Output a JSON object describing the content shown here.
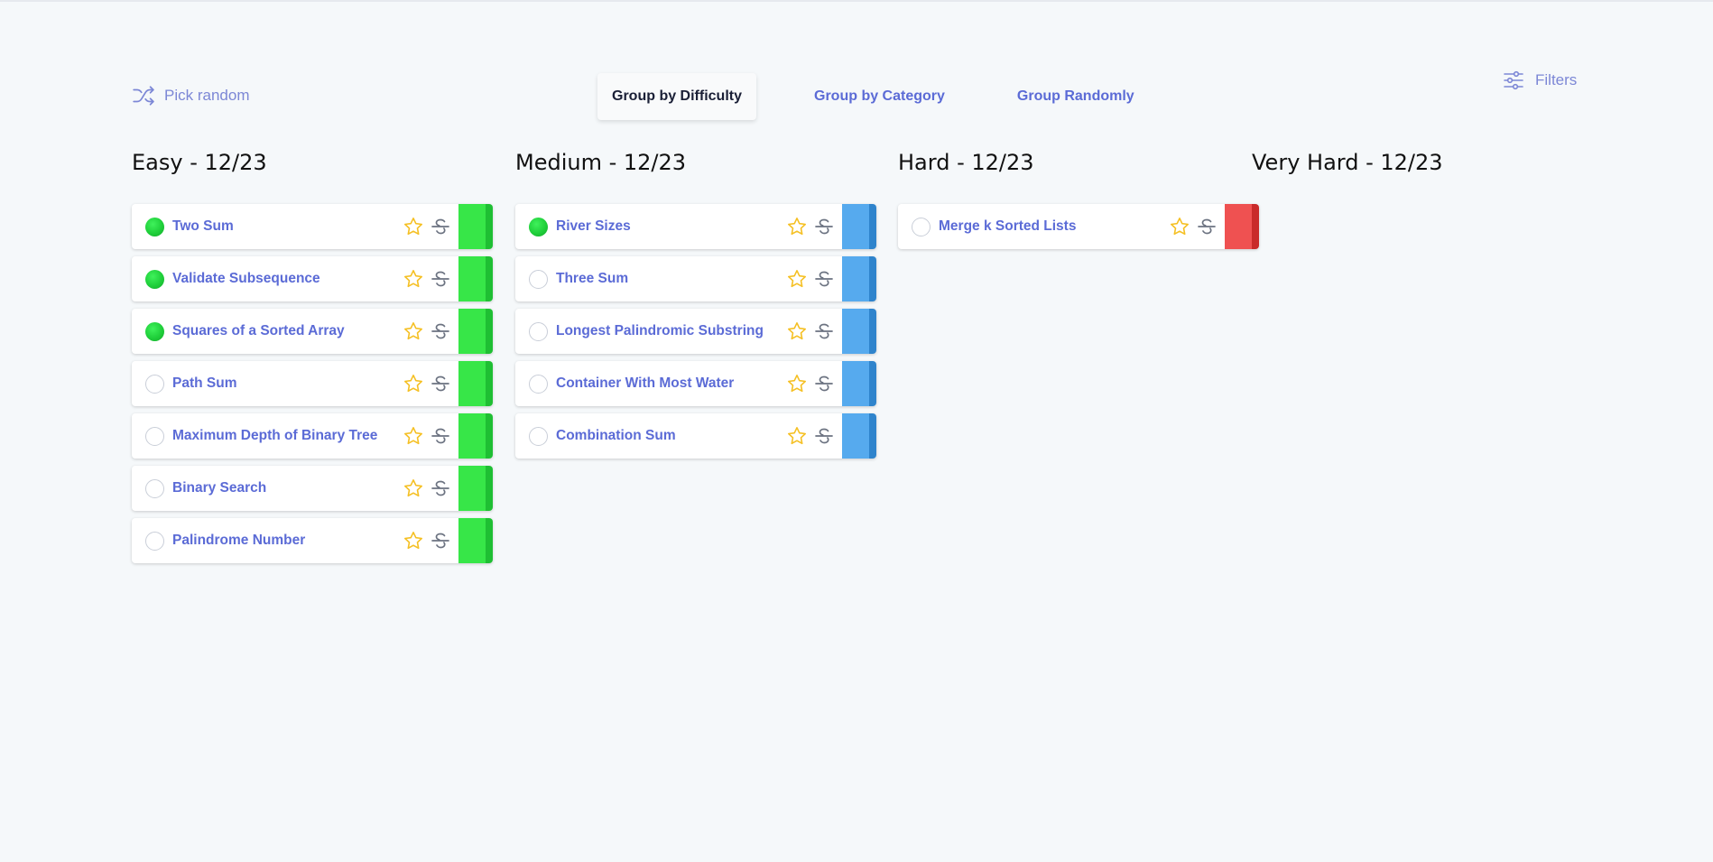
{
  "toolbar": {
    "pick_random_label": "Pick random",
    "tabs": [
      {
        "label": "Group by Difficulty",
        "active": true
      },
      {
        "label": "Group by Category",
        "active": false
      },
      {
        "label": "Group Randomly",
        "active": false
      }
    ],
    "filters_label": "Filters"
  },
  "colors": {
    "accent": "#5b6bd6",
    "easy": "#37e648",
    "easy_dark": "#1fbf33",
    "medium": "#56aaee",
    "medium_dark": "#2f84cc",
    "hard": "#ef5151",
    "hard_dark": "#c92a2a",
    "star": "#f5c024"
  },
  "columns": [
    {
      "title": "Easy - 12/23",
      "difficulty": "easy",
      "problems": [
        {
          "title": "Two Sum",
          "completed": true
        },
        {
          "title": "Validate Subsequence",
          "completed": true
        },
        {
          "title": "Squares of a Sorted Array",
          "completed": true
        },
        {
          "title": "Path Sum",
          "completed": false
        },
        {
          "title": "Maximum Depth of Binary Tree",
          "completed": false
        },
        {
          "title": "Binary Search",
          "completed": false
        },
        {
          "title": "Palindrome Number",
          "completed": false
        }
      ]
    },
    {
      "title": "Medium - 12/23",
      "difficulty": "medium",
      "problems": [
        {
          "title": "River Sizes",
          "completed": true
        },
        {
          "title": "Three Sum",
          "completed": false
        },
        {
          "title": "Longest Palindromic Substring",
          "completed": false
        },
        {
          "title": "Container With Most Water",
          "completed": false
        },
        {
          "title": "Combination Sum",
          "completed": false
        }
      ]
    },
    {
      "title": "Hard - 12/23",
      "difficulty": "hard",
      "problems": [
        {
          "title": "Merge k Sorted Lists",
          "completed": false
        }
      ]
    },
    {
      "title": "Very Hard - 12/23",
      "difficulty": "very_hard",
      "problems": []
    }
  ]
}
